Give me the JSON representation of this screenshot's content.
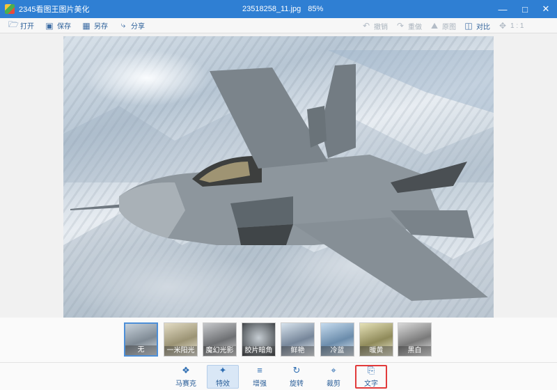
{
  "window": {
    "app_title": "2345看图王图片美化",
    "file_name": "23518258_11.jpg",
    "zoom": "85%"
  },
  "toolbar": {
    "left": [
      {
        "label": "打开",
        "icon": "folder-open-icon"
      },
      {
        "label": "保存",
        "icon": "save-icon"
      },
      {
        "label": "另存",
        "icon": "save-as-icon"
      },
      {
        "label": "分享",
        "icon": "share-icon"
      }
    ],
    "right": [
      {
        "label": "撤销",
        "icon": "undo-icon"
      },
      {
        "label": "重做",
        "icon": "redo-icon"
      },
      {
        "label": "原图",
        "icon": "image-icon"
      },
      {
        "label": "对比",
        "icon": "compare-icon"
      },
      {
        "label": "1 : 1",
        "icon": "fit-icon"
      }
    ]
  },
  "filters": [
    {
      "label": "无",
      "selected": true
    },
    {
      "label": "一米阳光"
    },
    {
      "label": "魔幻光影"
    },
    {
      "label": "胶片暗角"
    },
    {
      "label": "鲜艳"
    },
    {
      "label": "冷蓝"
    },
    {
      "label": "暖黄"
    },
    {
      "label": "黑白"
    }
  ],
  "tools": [
    {
      "label": "马赛克",
      "icon": "mosaic-icon"
    },
    {
      "label": "特效",
      "icon": "magic-wand-icon",
      "active": true
    },
    {
      "label": "增强",
      "icon": "sliders-icon"
    },
    {
      "label": "旋转",
      "icon": "rotate-icon"
    },
    {
      "label": "裁剪",
      "icon": "crop-icon"
    },
    {
      "label": "文字",
      "icon": "text-icon",
      "highlighted": true
    }
  ],
  "colors": {
    "titlebar": "#2f7fd3",
    "accent": "#2b5f99",
    "highlight_outline": "#e23a3a"
  }
}
